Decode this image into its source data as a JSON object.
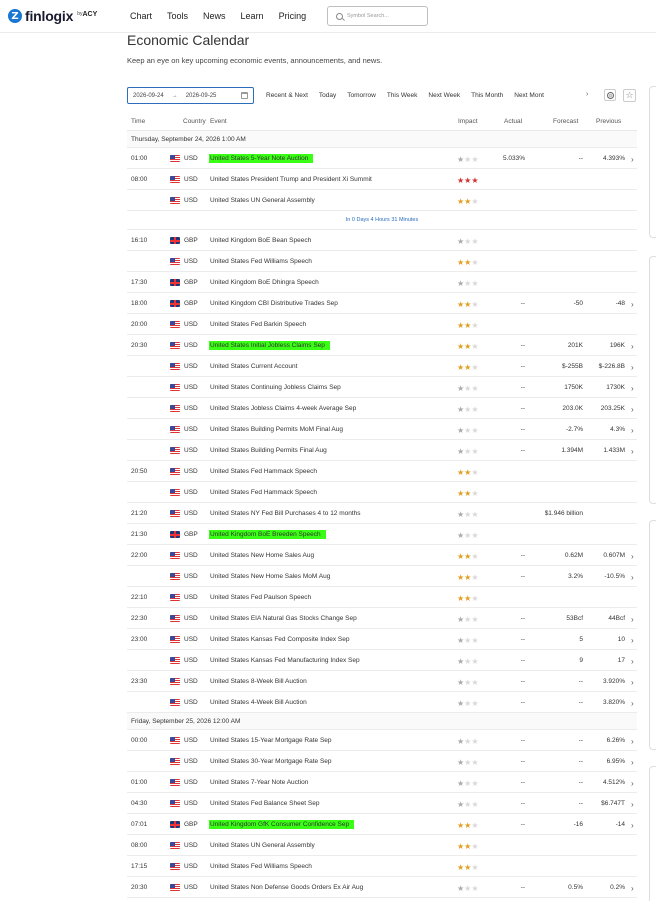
{
  "header": {
    "logo_text": "finlogix",
    "logo_by": "by",
    "logo_acy": "ACY",
    "nav": [
      "Chart",
      "Tools",
      "News",
      "Learn",
      "Pricing"
    ],
    "search_placeholder": "Symbol Search..."
  },
  "page": {
    "title": "Economic Calendar",
    "subtitle": "Keep an eye on key upcoming economic events, announcements, and news."
  },
  "filters": {
    "date_from": "2026-09-24",
    "date_arrow": "→",
    "date_to": "2026-09-25",
    "options": [
      "Recent & Next",
      "Today",
      "Tomorrow",
      "This Week",
      "Next Week",
      "This Month",
      "Next Mont"
    ],
    "more": "›"
  },
  "table": {
    "columns": {
      "time": "Time",
      "country": "Country",
      "event": "Event",
      "impact": "Impact",
      "actual": "Actual",
      "forecast": "Forecast",
      "previous": "Previous"
    },
    "days": [
      {
        "label": "Thursday, September 24, 2026 1:00 AM",
        "countdown": "In 0 Days 4 Hours 31 Minutes",
        "countdown_after": 3,
        "events": [
          {
            "time": "01:00",
            "flag": "us",
            "cur": "USD",
            "event": "United States 5-Year Note Auction",
            "hl": true,
            "impact": 1,
            "actual": "5.033%",
            "forecast": "--",
            "previous": "4.393%",
            "chev": true
          },
          {
            "time": "08:00",
            "flag": "us",
            "cur": "USD",
            "event": "United States President Trump and President Xi Summit",
            "hl": false,
            "impact": 3,
            "actual": "",
            "forecast": "",
            "previous": "",
            "chev": false
          },
          {
            "time": "",
            "flag": "us",
            "cur": "USD",
            "event": "United States UN General Assembly",
            "hl": false,
            "impact": 2,
            "actual": "",
            "forecast": "",
            "previous": "",
            "chev": false
          },
          {
            "time": "16:10",
            "flag": "gb",
            "cur": "GBP",
            "event": "United Kingdom BoE Bean Speech",
            "hl": false,
            "impact": 1,
            "actual": "",
            "forecast": "",
            "previous": "",
            "chev": false
          },
          {
            "time": "",
            "flag": "us",
            "cur": "USD",
            "event": "United States Fed Williams Speech",
            "hl": false,
            "impact": 2,
            "actual": "",
            "forecast": "",
            "previous": "",
            "chev": false
          },
          {
            "time": "17:30",
            "flag": "gb",
            "cur": "GBP",
            "event": "United Kingdom BoE Dhingra Speech",
            "hl": false,
            "impact": 1,
            "actual": "",
            "forecast": "",
            "previous": "",
            "chev": false
          },
          {
            "time": "18:00",
            "flag": "gb",
            "cur": "GBP",
            "event": "United Kingdom CBI Distributive Trades Sep",
            "hl": false,
            "impact": 2,
            "actual": "--",
            "forecast": "-50",
            "previous": "-48",
            "chev": true
          },
          {
            "time": "20:00",
            "flag": "us",
            "cur": "USD",
            "event": "United States Fed Barkin Speech",
            "hl": false,
            "impact": 2,
            "actual": "",
            "forecast": "",
            "previous": "",
            "chev": false
          },
          {
            "time": "20:30",
            "flag": "us",
            "cur": "USD",
            "event": "United States Initial Jobless Claims Sep",
            "hl": true,
            "impact": 2,
            "actual": "--",
            "forecast": "201K",
            "previous": "196K",
            "chev": true
          },
          {
            "time": "",
            "flag": "us",
            "cur": "USD",
            "event": "United States Current Account",
            "hl": false,
            "impact": 2,
            "actual": "--",
            "forecast": "$-255B",
            "previous": "$-226.8B",
            "chev": true
          },
          {
            "time": "",
            "flag": "us",
            "cur": "USD",
            "event": "United States Continuing Jobless Claims Sep",
            "hl": false,
            "impact": 1,
            "actual": "--",
            "forecast": "1750K",
            "previous": "1730K",
            "chev": true
          },
          {
            "time": "",
            "flag": "us",
            "cur": "USD",
            "event": "United States Jobless Claims 4-week Average Sep",
            "hl": false,
            "impact": 1,
            "actual": "--",
            "forecast": "203.0K",
            "previous": "203.25K",
            "chev": true
          },
          {
            "time": "",
            "flag": "us",
            "cur": "USD",
            "event": "United States Building Permits MoM Final Aug",
            "hl": false,
            "impact": 1,
            "actual": "--",
            "forecast": "-2.7%",
            "previous": "4.3%",
            "chev": true
          },
          {
            "time": "",
            "flag": "us",
            "cur": "USD",
            "event": "United States Building Permits Final Aug",
            "hl": false,
            "impact": 1,
            "actual": "--",
            "forecast": "1.394M",
            "previous": "1.433M",
            "chev": true
          },
          {
            "time": "20:50",
            "flag": "us",
            "cur": "USD",
            "event": "United States Fed Hammack Speech",
            "hl": false,
            "impact": 2,
            "actual": "",
            "forecast": "",
            "previous": "",
            "chev": false
          },
          {
            "time": "",
            "flag": "us",
            "cur": "USD",
            "event": "United States Fed Hammack Speech",
            "hl": false,
            "impact": 2,
            "actual": "",
            "forecast": "",
            "previous": "",
            "chev": false
          },
          {
            "time": "21:20",
            "flag": "us",
            "cur": "USD",
            "event": "United States NY Fed Bill Purchases 4 to 12 months",
            "hl": false,
            "impact": 1,
            "actual": "",
            "forecast": "$1.946 billion",
            "previous": "",
            "chev": false
          },
          {
            "time": "21:30",
            "flag": "gb",
            "cur": "GBP",
            "event": "United Kingdom BoE Breeden Speech",
            "hl": true,
            "impact": 1,
            "actual": "",
            "forecast": "",
            "previous": "",
            "chev": false
          },
          {
            "time": "22:00",
            "flag": "us",
            "cur": "USD",
            "event": "United States New Home Sales Aug",
            "hl": false,
            "impact": 2,
            "actual": "--",
            "forecast": "0.62M",
            "previous": "0.607M",
            "chev": true
          },
          {
            "time": "",
            "flag": "us",
            "cur": "USD",
            "event": "United States New Home Sales MoM Aug",
            "hl": false,
            "impact": 2,
            "actual": "--",
            "forecast": "3.2%",
            "previous": "-10.5%",
            "chev": true
          },
          {
            "time": "22:10",
            "flag": "us",
            "cur": "USD",
            "event": "United States Fed Paulson Speech",
            "hl": false,
            "impact": 2,
            "actual": "",
            "forecast": "",
            "previous": "",
            "chev": false
          },
          {
            "time": "22:30",
            "flag": "us",
            "cur": "USD",
            "event": "United States EIA Natural Gas Stocks Change Sep",
            "hl": false,
            "impact": 1,
            "actual": "--",
            "forecast": "53Bcf",
            "previous": "44Bcf",
            "chev": true
          },
          {
            "time": "23:00",
            "flag": "us",
            "cur": "USD",
            "event": "United States Kansas Fed Composite Index Sep",
            "hl": false,
            "impact": 1,
            "actual": "--",
            "forecast": "5",
            "previous": "10",
            "chev": true
          },
          {
            "time": "",
            "flag": "us",
            "cur": "USD",
            "event": "United States Kansas Fed Manufacturing Index Sep",
            "hl": false,
            "impact": 1,
            "actual": "--",
            "forecast": "9",
            "previous": "17",
            "chev": true
          },
          {
            "time": "23:30",
            "flag": "us",
            "cur": "USD",
            "event": "United States 8-Week Bill Auction",
            "hl": false,
            "impact": 1,
            "actual": "--",
            "forecast": "--",
            "previous": "3.920%",
            "chev": true
          },
          {
            "time": "",
            "flag": "us",
            "cur": "USD",
            "event": "United States 4-Week Bill Auction",
            "hl": false,
            "impact": 1,
            "actual": "--",
            "forecast": "--",
            "previous": "3.820%",
            "chev": true
          }
        ]
      },
      {
        "label": "Friday, September 25, 2026 12:00 AM",
        "countdown": "",
        "countdown_after": -1,
        "events": [
          {
            "time": "00:00",
            "flag": "us",
            "cur": "USD",
            "event": "United States 15-Year Mortgage Rate Sep",
            "hl": false,
            "impact": 1,
            "actual": "--",
            "forecast": "--",
            "previous": "6.26%",
            "chev": true
          },
          {
            "time": "",
            "flag": "us",
            "cur": "USD",
            "event": "United States 30-Year Mortgage Rate Sep",
            "hl": false,
            "impact": 1,
            "actual": "--",
            "forecast": "--",
            "previous": "6.95%",
            "chev": true
          },
          {
            "time": "01:00",
            "flag": "us",
            "cur": "USD",
            "event": "United States 7-Year Note Auction",
            "hl": false,
            "impact": 1,
            "actual": "--",
            "forecast": "--",
            "previous": "4.512%",
            "chev": true
          },
          {
            "time": "04:30",
            "flag": "us",
            "cur": "USD",
            "event": "United States Fed Balance Sheet Sep",
            "hl": false,
            "impact": 1,
            "actual": "--",
            "forecast": "--",
            "previous": "$6.747T",
            "chev": true
          },
          {
            "time": "07:01",
            "flag": "gb",
            "cur": "GBP",
            "event": "United Kingdom GfK Consumer Confidence Sep",
            "hl": true,
            "impact": 2,
            "actual": "--",
            "forecast": "-16",
            "previous": "-14",
            "chev": true
          },
          {
            "time": "08:00",
            "flag": "us",
            "cur": "USD",
            "event": "United States UN General Assembly",
            "hl": false,
            "impact": 2,
            "actual": "",
            "forecast": "",
            "previous": "",
            "chev": false
          },
          {
            "time": "17:15",
            "flag": "us",
            "cur": "USD",
            "event": "United States Fed Williams Speech",
            "hl": false,
            "impact": 2,
            "actual": "",
            "forecast": "",
            "previous": "",
            "chev": false
          },
          {
            "time": "20:30",
            "flag": "us",
            "cur": "USD",
            "event": "United States Non Defense Goods Orders Ex Air Aug",
            "hl": false,
            "impact": 1,
            "actual": "--",
            "forecast": "0.5%",
            "previous": "0.2%",
            "chev": true
          }
        ]
      }
    ]
  },
  "colors": {
    "highlight": "#39ff14",
    "accent": "#2a6ebd",
    "impact_high": "#d32f2f",
    "impact_med": "#e0a020"
  }
}
